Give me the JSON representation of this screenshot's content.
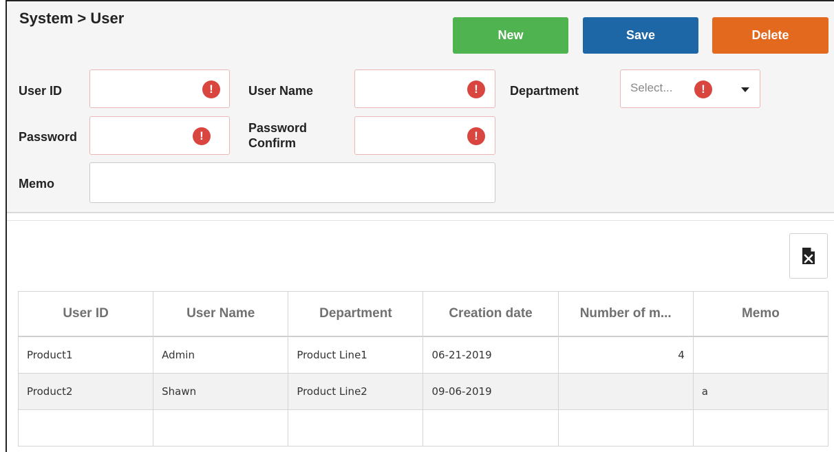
{
  "breadcrumb": "System > User",
  "toolbar": {
    "new_label": "New",
    "save_label": "Save",
    "delete_label": "Delete"
  },
  "form": {
    "user_id_label": "User ID",
    "user_name_label": "User Name",
    "department_label": "Department",
    "department_placeholder": "Select...",
    "password_label": "Password",
    "password_confirm_label_line1": "Password",
    "password_confirm_label_line2": "Confirm",
    "memo_label": "Memo",
    "required_icon_glyph": "!"
  },
  "grid": {
    "columns": [
      "User ID",
      "User Name",
      "Department",
      "Creation date",
      "Number of m...",
      "Memo"
    ],
    "rows": [
      [
        "Product1",
        "Admin",
        "Product Line1",
        "06-21-2019",
        "4",
        ""
      ],
      [
        "Product2",
        "Shawn",
        "Product Line2",
        "09-06-2019",
        "",
        "a"
      ],
      [
        "",
        "",
        "",
        "",
        "",
        ""
      ]
    ]
  },
  "colors": {
    "new": "#4fb350",
    "save": "#1d67a6",
    "delete": "#e2691e",
    "required": "#d9463f"
  }
}
